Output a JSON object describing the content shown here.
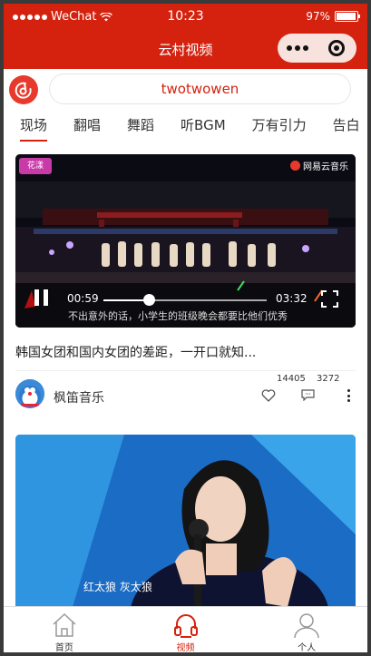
{
  "status_bar": {
    "carrier": "WeChat",
    "time": "10:23",
    "battery": "97%"
  },
  "nav_bar": {
    "title": "云村视频"
  },
  "search": {
    "placeholder": "twotwowen"
  },
  "tabs": [
    {
      "label": "现场",
      "active": true
    },
    {
      "label": "翻唱",
      "active": false
    },
    {
      "label": "舞蹈",
      "active": false
    },
    {
      "label": "听BGM",
      "active": false
    },
    {
      "label": "万有引力",
      "active": false
    },
    {
      "label": "告白",
      "active": false
    }
  ],
  "video1": {
    "tag": "花漾",
    "brand": "网易云音乐",
    "current_time": "00:59",
    "duration": "03:32",
    "progress": 0.28,
    "subtitle": "不出意外的话，小学生的班级晚会都要比他们优秀",
    "title": "韩国女团和国内女团的差距，一开口就知...",
    "author": "枫笛音乐",
    "likes": "14405",
    "comments": "3272"
  },
  "video2": {
    "caption": "红太狼 灰太狼"
  },
  "tab_bar": [
    {
      "label": "首页",
      "icon": "home-icon",
      "active": false
    },
    {
      "label": "视频",
      "icon": "headphones-icon",
      "active": true
    },
    {
      "label": "个人",
      "icon": "user-icon",
      "active": false
    }
  ],
  "colors": {
    "brand_red": "#d4220f",
    "accent_red": "#e73a2d"
  }
}
